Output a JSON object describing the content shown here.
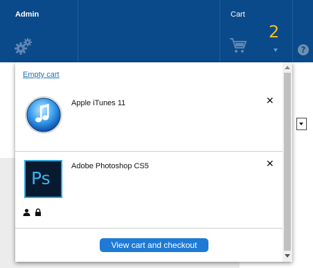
{
  "header": {
    "admin_label": "Admin",
    "admin_icon": "gears-icon",
    "cart_label": "Cart",
    "cart_count": "2",
    "cart_icon": "shopping-cart-icon",
    "help_icon": "question-circle-icon",
    "help_glyph": "?"
  },
  "cart_dropdown": {
    "empty_cart_label": "Empty cart",
    "items": [
      {
        "name": "Apple iTunes 11",
        "logo": "itunes-logo",
        "remove_glyph": "✕"
      },
      {
        "name": "Adobe Photoshop CS5",
        "logo": "photoshop-logo",
        "logo_text": "Ps",
        "remove_glyph": "✕",
        "status_icons": [
          "user-icon",
          "lock-icon"
        ]
      }
    ],
    "checkout_label": "View cart and checkout"
  },
  "colors": {
    "header_bg": "#0a4a8a",
    "cart_count": "#f0c020",
    "button_bg": "#1f7ad6",
    "link": "#1f6fb6"
  }
}
